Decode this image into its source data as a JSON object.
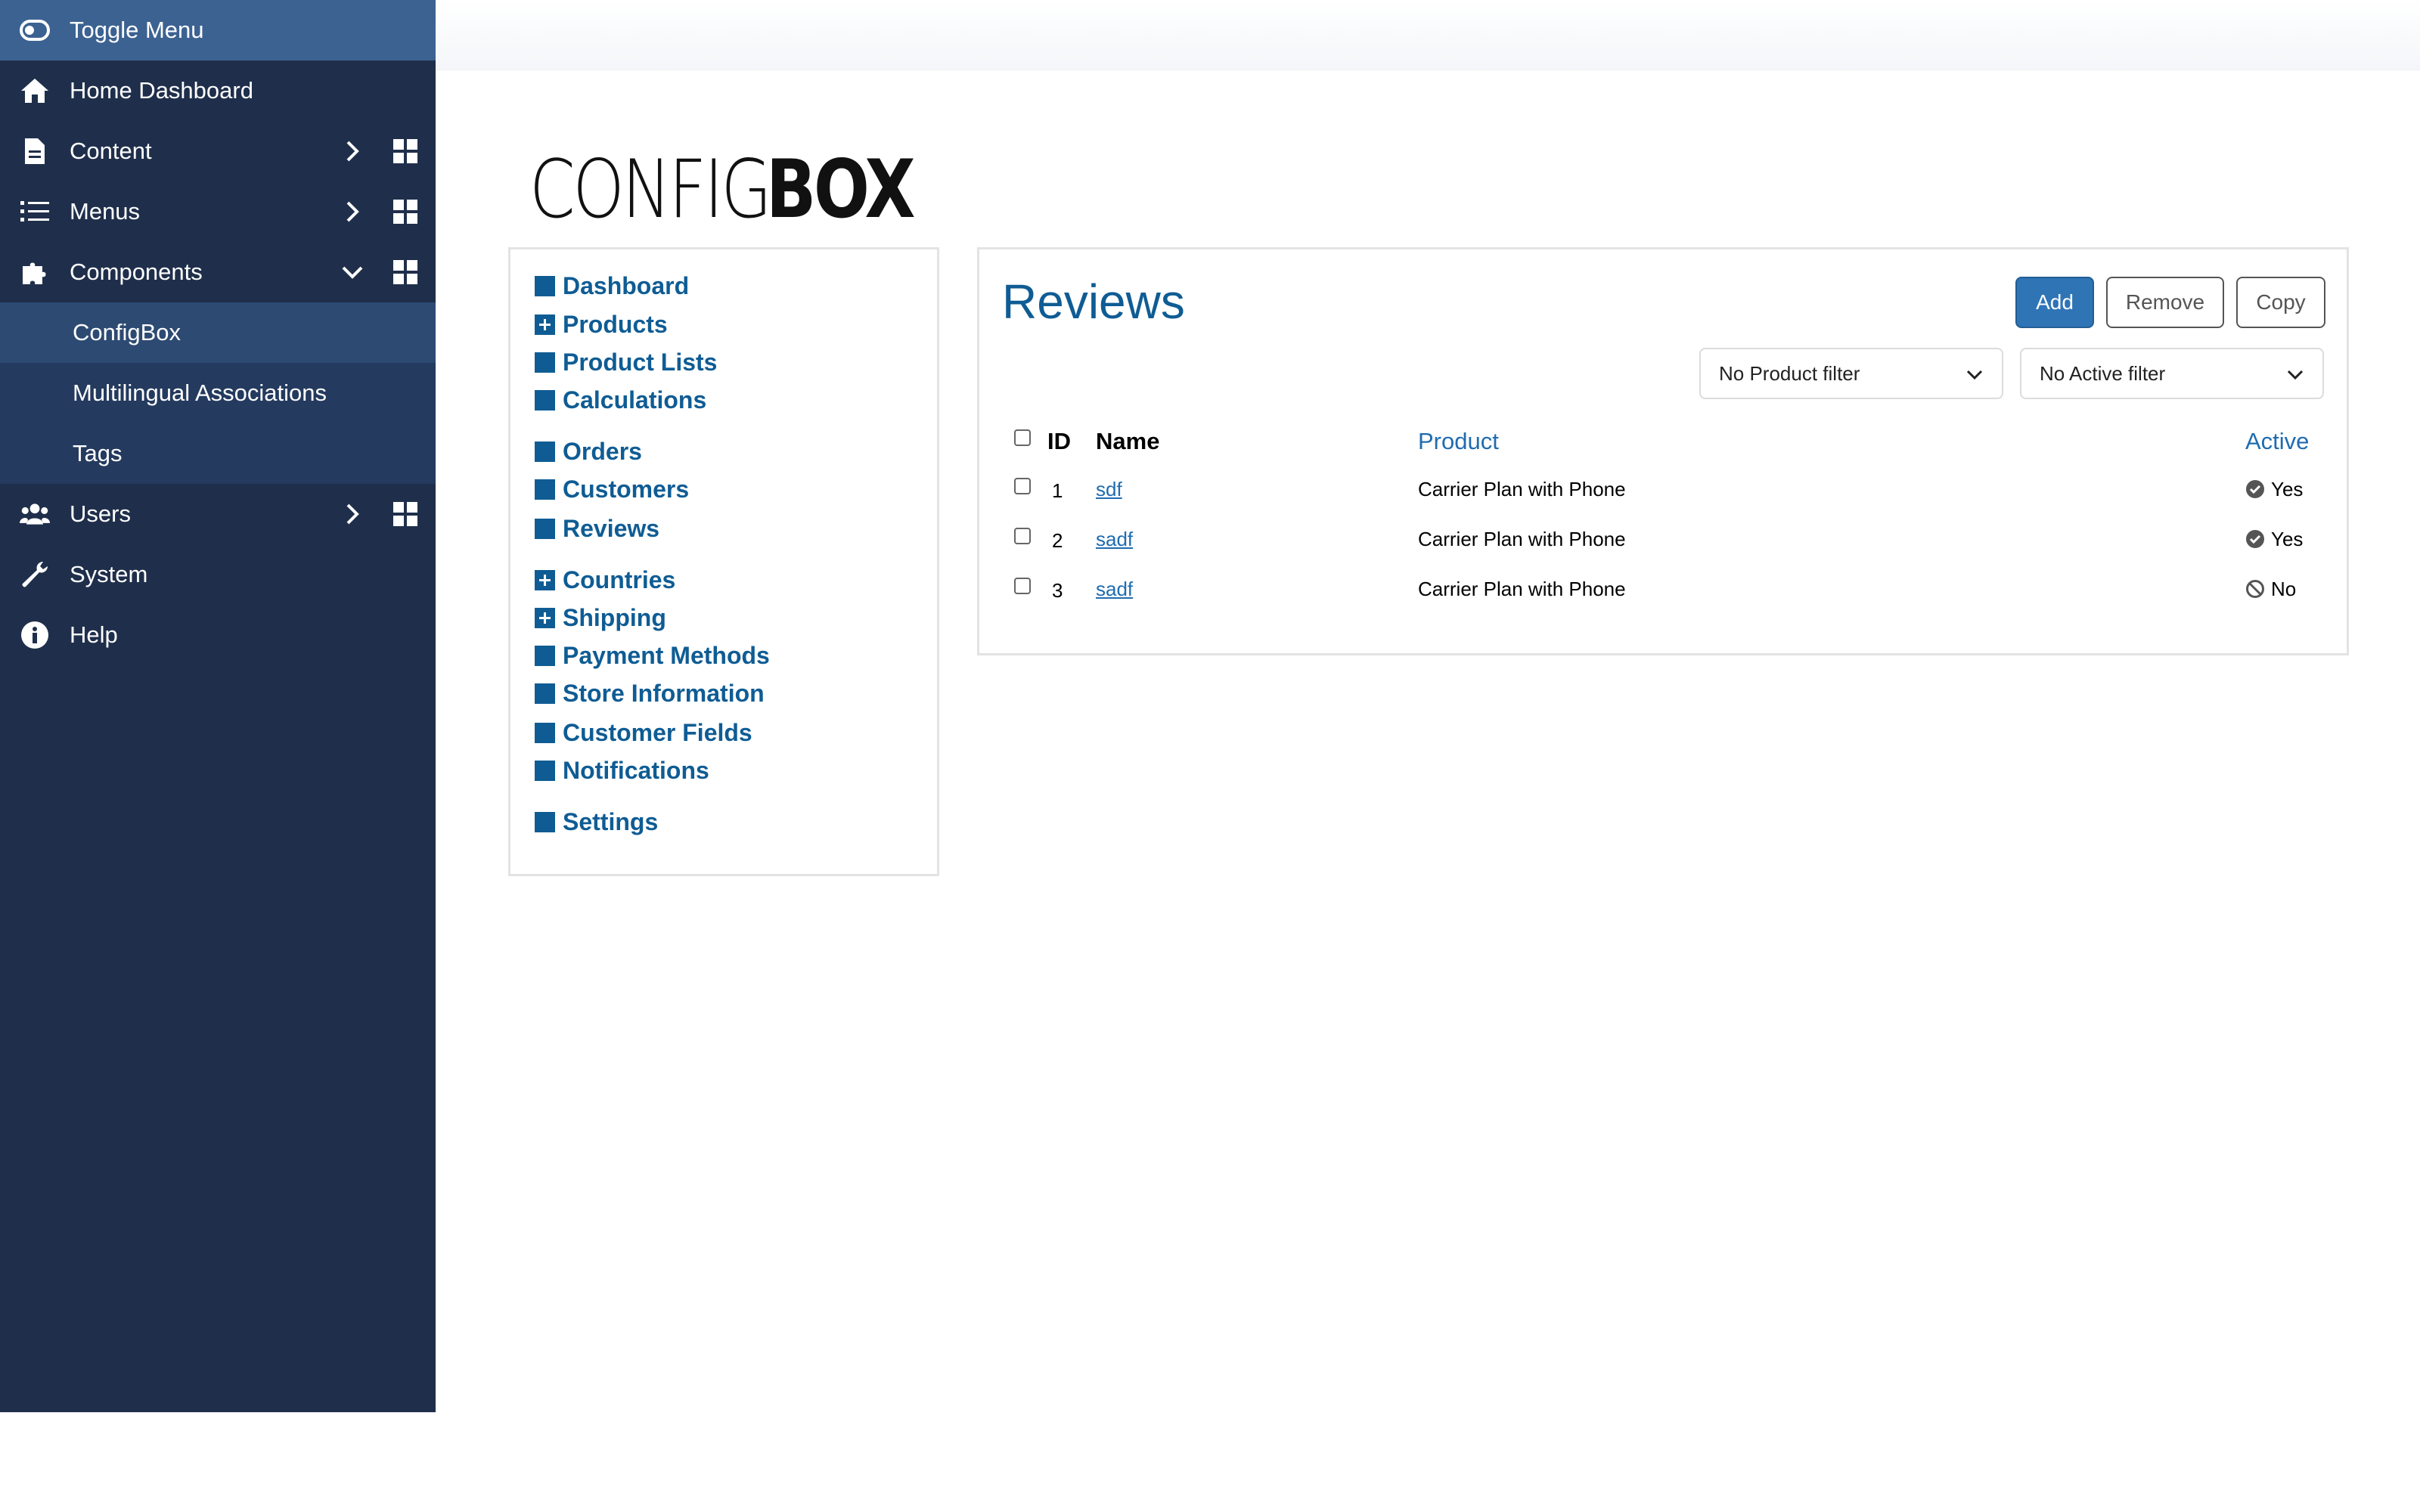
{
  "sidebar": {
    "toggle_label": "Toggle Menu",
    "items": [
      {
        "label": "Home Dashboard",
        "icon": "home-icon"
      },
      {
        "label": "Content",
        "icon": "file-icon"
      },
      {
        "label": "Menus",
        "icon": "list-icon"
      },
      {
        "label": "Components",
        "icon": "puzzle-icon"
      },
      {
        "label": "ConfigBox"
      },
      {
        "label": "Multilingual Associations"
      },
      {
        "label": "Tags"
      },
      {
        "label": "Users",
        "icon": "users-icon"
      },
      {
        "label": "System",
        "icon": "wrench-icon"
      },
      {
        "label": "Help",
        "icon": "info-icon"
      }
    ]
  },
  "logo": {
    "thin": "CONFIG",
    "bold": "BOX"
  },
  "nav": [
    {
      "label": "Dashboard",
      "icon": "square"
    },
    {
      "label": "Products",
      "icon": "plus"
    },
    {
      "label": "Product Lists",
      "icon": "square"
    },
    {
      "label": "Calculations",
      "icon": "square"
    },
    {
      "label": "Orders",
      "icon": "square"
    },
    {
      "label": "Customers",
      "icon": "square"
    },
    {
      "label": "Reviews",
      "icon": "square"
    },
    {
      "label": "Countries",
      "icon": "plus"
    },
    {
      "label": "Shipping",
      "icon": "plus"
    },
    {
      "label": "Payment Methods",
      "icon": "square"
    },
    {
      "label": "Store Information",
      "icon": "square"
    },
    {
      "label": "Customer Fields",
      "icon": "square"
    },
    {
      "label": "Notifications",
      "icon": "square"
    },
    {
      "label": "Settings",
      "icon": "square"
    }
  ],
  "panel": {
    "title": "Reviews",
    "buttons": {
      "add": "Add",
      "remove": "Remove",
      "copy": "Copy"
    },
    "filters": {
      "product": "No Product filter",
      "active": "No Active filter"
    },
    "columns": {
      "id": "ID",
      "name": "Name",
      "product": "Product",
      "active": "Active"
    },
    "rows": [
      {
        "id": "1",
        "name": "sdf",
        "product": "Carrier Plan with Phone",
        "active": "Yes"
      },
      {
        "id": "2",
        "name": "sadf",
        "product": "Carrier Plan with Phone",
        "active": "Yes"
      },
      {
        "id": "3",
        "name": "sadf",
        "product": "Carrier Plan with Phone",
        "active": "No"
      }
    ]
  },
  "colors": {
    "sidebar": "#1f2f4b",
    "accent": "#0f5c94",
    "button_primary": "#2f74b5"
  }
}
